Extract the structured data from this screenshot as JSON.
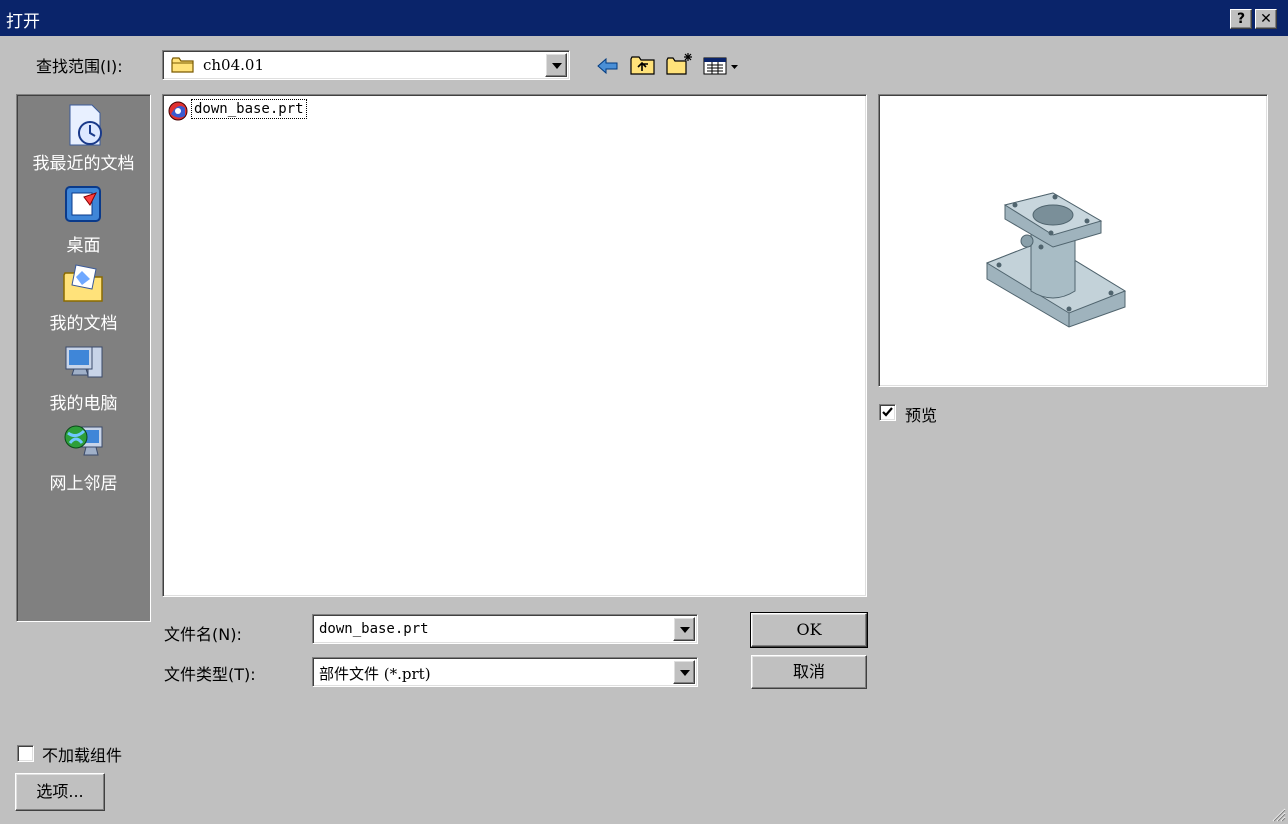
{
  "window": {
    "title": "打开",
    "help_label": "?",
    "close_label": "✕"
  },
  "lookin": {
    "label": "查找范围(I):",
    "value": "ch04.01"
  },
  "toolbar": {
    "back_icon": "back-arrow-icon",
    "up_icon": "up-folder-icon",
    "new_folder_icon": "new-folder-icon",
    "view_icon": "view-menu-icon"
  },
  "places": [
    {
      "label": "我最近的文档",
      "icon": "recent-documents-icon"
    },
    {
      "label": "桌面",
      "icon": "desktop-icon"
    },
    {
      "label": "我的文档",
      "icon": "my-documents-icon"
    },
    {
      "label": "我的电脑",
      "icon": "my-computer-icon"
    },
    {
      "label": "网上邻居",
      "icon": "network-places-icon"
    }
  ],
  "files": [
    {
      "name": "down_base.prt",
      "icon": "nx-part-icon"
    }
  ],
  "preview": {
    "checkbox_label": "预览",
    "checked": true
  },
  "filename": {
    "label": "文件名(N):",
    "value": "down_base.prt"
  },
  "filetype": {
    "label": "文件类型(T):",
    "value": "部件文件 (*.prt)"
  },
  "buttons": {
    "ok": "OK",
    "cancel": "取消",
    "options": "选项..."
  },
  "no_load_components": {
    "label": "不加载组件",
    "checked": false
  }
}
